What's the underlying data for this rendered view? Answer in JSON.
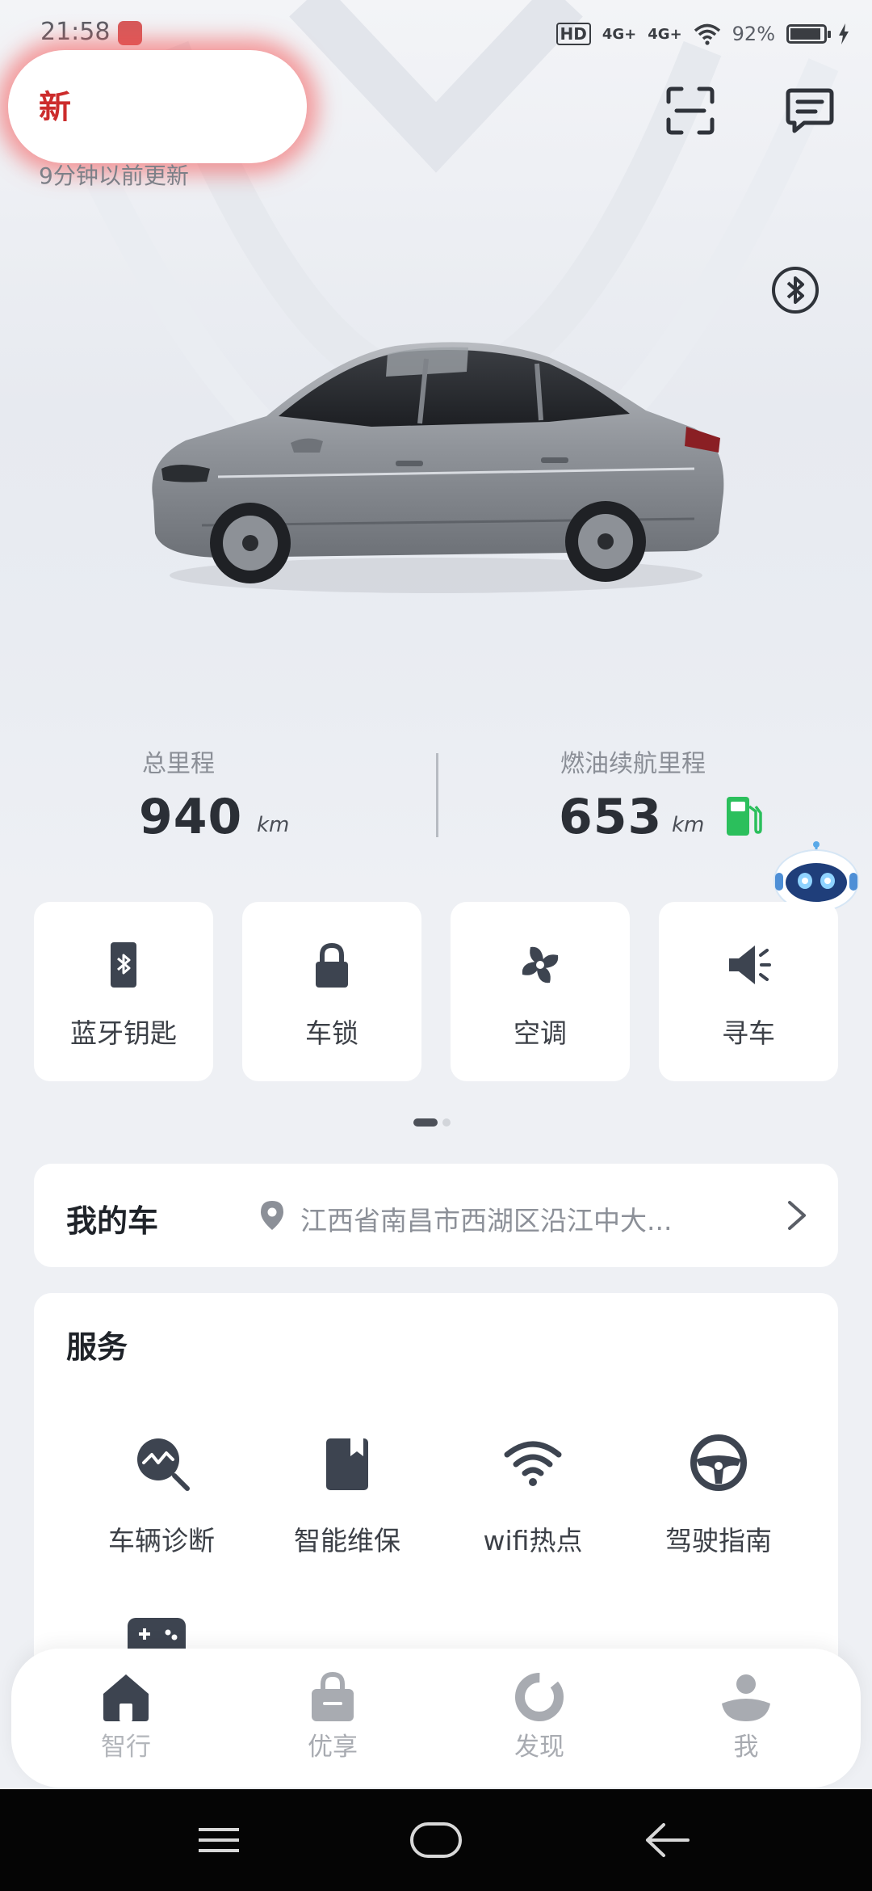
{
  "status_bar": {
    "time": "21:58",
    "network_1": "4G+",
    "network_2": "4G+",
    "hd_label": "HD",
    "battery_percent": "92%",
    "battery_level": 0.92
  },
  "header": {
    "car_name": "新",
    "update_time": "9分钟以前更新"
  },
  "stats": {
    "total_mileage_label": "总里程",
    "total_mileage_value": "940",
    "total_mileage_unit": "km",
    "fuel_range_label": "燃油续航里程",
    "fuel_range_value": "653",
    "fuel_range_unit": "km"
  },
  "quick_actions": [
    {
      "label": "蓝牙钥匙",
      "icon": "bluetooth-key-icon"
    },
    {
      "label": "车锁",
      "icon": "lock-icon"
    },
    {
      "label": "空调",
      "icon": "fan-icon"
    },
    {
      "label": "寻车",
      "icon": "horn-icon"
    }
  ],
  "my_car": {
    "title": "我的车",
    "location": "江西省南昌市西湖区沿江中大..."
  },
  "services": {
    "title": "服务",
    "items": [
      {
        "label": "车辆诊断",
        "icon": "diagnosis-icon"
      },
      {
        "label": "智能维保",
        "icon": "maintenance-icon"
      },
      {
        "label": "wifi热点",
        "icon": "wifi-icon"
      },
      {
        "label": "驾驶指南",
        "icon": "steering-wheel-icon"
      }
    ]
  },
  "tabs": [
    {
      "label": "智行",
      "icon": "home-icon"
    },
    {
      "label": "优享",
      "icon": "bag-icon"
    },
    {
      "label": "发现",
      "icon": "discover-icon"
    },
    {
      "label": "我",
      "icon": "profile-icon"
    }
  ],
  "colors": {
    "accent_dark": "#3d4450",
    "fuel_green": "#2bbf5c",
    "tab_inactive": "#a8abb1"
  }
}
